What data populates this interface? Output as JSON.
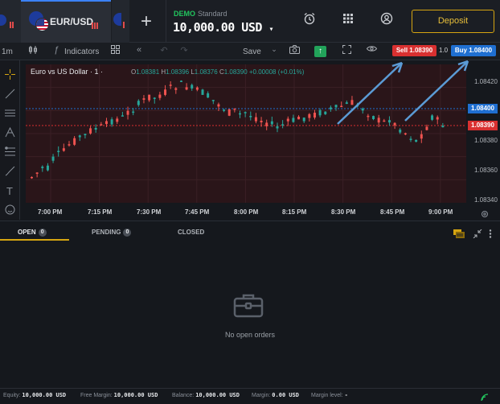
{
  "header": {
    "pair": "EUR/USD",
    "new_tab": "+",
    "account_type": "DEMO",
    "account_plan": "Standard",
    "balance": "10,000.00 USD",
    "deposit_label": "Deposit",
    "caret": "▾"
  },
  "toolbar": {
    "timeframe": "1m",
    "indicators_label": "Indicators",
    "save_label": "Save",
    "sell_label": "Sell 1.08390",
    "lot": "1.0",
    "buy_label": "Buy 1.08400"
  },
  "chart": {
    "title": "Euro vs US Dollar · 1 ·",
    "o_label": "O",
    "o_value": "1.08381",
    "h_label": "H",
    "h_value": "1.08396",
    "l_label": "L",
    "l_value": "1.08376",
    "c_label": "C",
    "c_value": "1.08390",
    "change": "+0.00008 (+0.01%)",
    "buy_tag": "1.08400",
    "sell_tag": "1.08390",
    "y_ticks": [
      "1.08420",
      "1.08380",
      "1.08360",
      "1.08340"
    ],
    "x_ticks": [
      "7:00 PM",
      "7:15 PM",
      "7:30 PM",
      "7:45 PM",
      "8:00 PM",
      "8:15 PM",
      "8:30 PM",
      "8:45 PM",
      "9:00 PM"
    ],
    "up_color": "#26a69a",
    "down_color": "#ef5350"
  },
  "positions": {
    "tabs": [
      {
        "label": "OPEN",
        "count": "0"
      },
      {
        "label": "PENDING",
        "count": "0"
      },
      {
        "label": "CLOSED"
      }
    ],
    "empty_text": "No open orders"
  },
  "status": {
    "equity_label": "Equity:",
    "equity": "10,000.00 USD",
    "free_margin_label": "Free Margin:",
    "free_margin": "10,000.00 USD",
    "balance_label": "Balance:",
    "balance": "10,000.00 USD",
    "margin_label": "Margin:",
    "margin": "0.00 USD",
    "margin_level_label": "Margin level:",
    "margin_level": "-"
  }
}
